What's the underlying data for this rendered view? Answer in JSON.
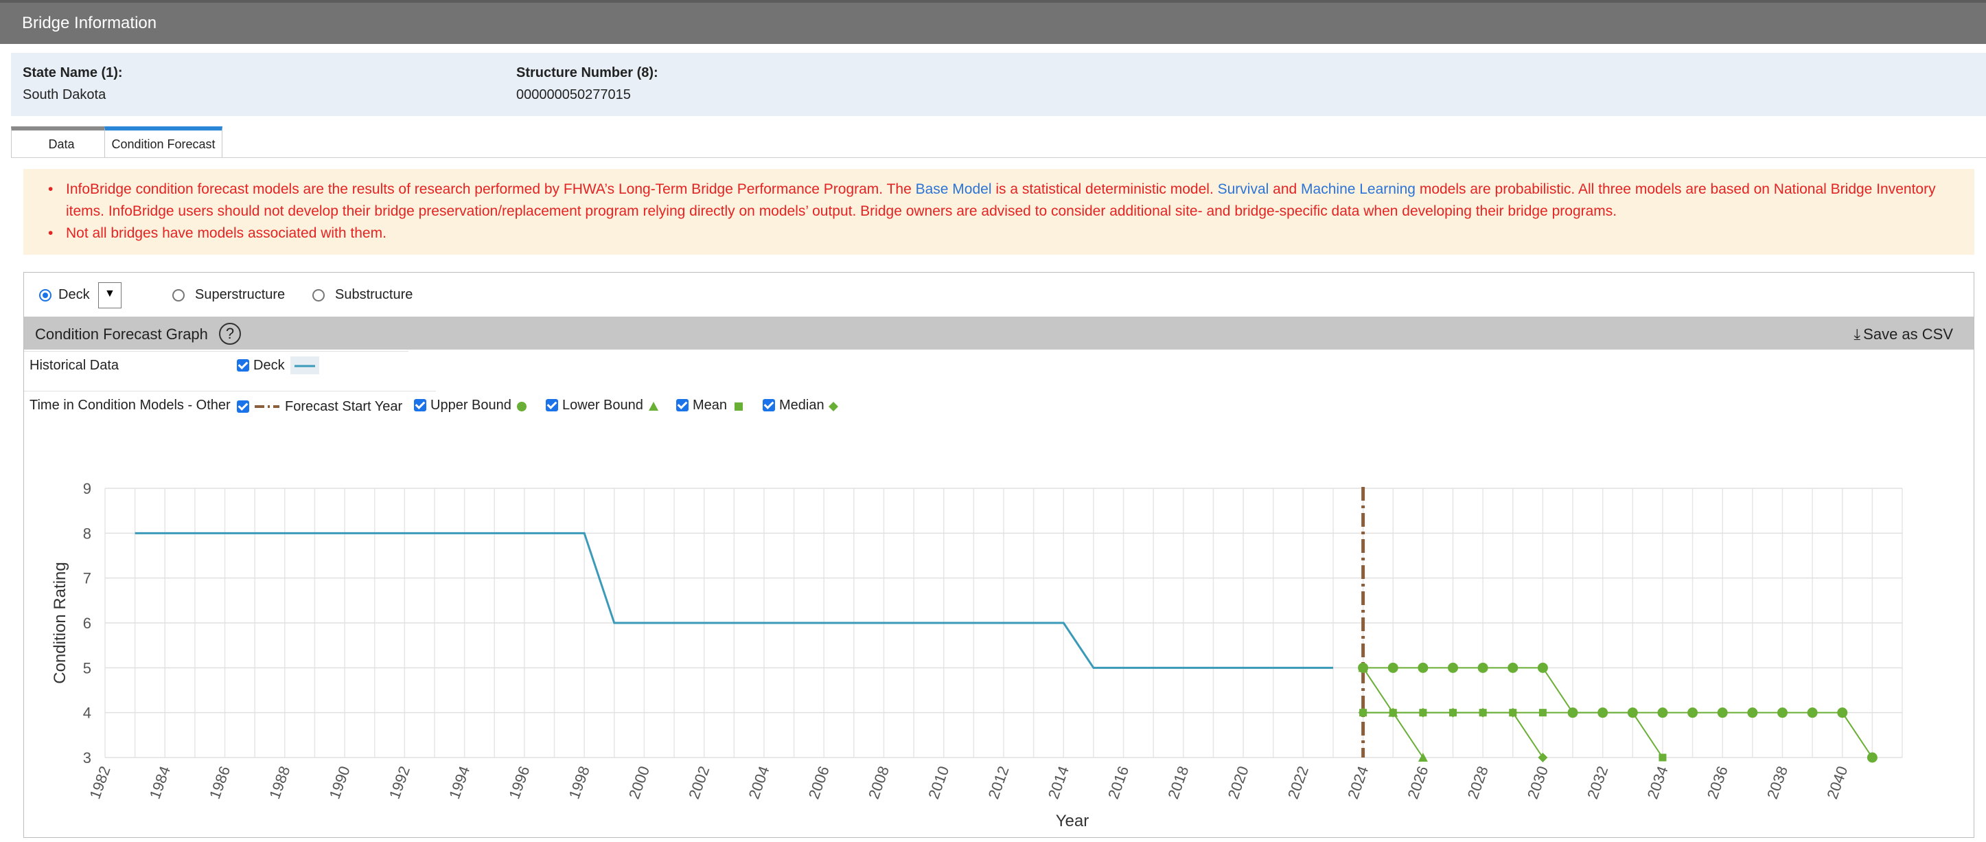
{
  "window": {
    "title": "Bridge Information"
  },
  "info": {
    "state_label": "State Name (1):",
    "state_value": "South Dakota",
    "structure_label": "Structure Number (8):",
    "structure_value": "000000050277015"
  },
  "tabs": [
    {
      "label": "Data",
      "active": false
    },
    {
      "label": "Condition Forecast",
      "active": true
    }
  ],
  "notice": {
    "line1_a": "InfoBridge condition forecast models are the results of research performed by FHWA’s Long-Term Bridge Performance Program. The ",
    "link_base": "Base Model",
    "line1_b": " is a statistical deterministic model. ",
    "link_survival": "Survival",
    "line1_c": " and ",
    "link_ml": "Machine Learning",
    "line1_d": " models are probabilistic. All three models are based on National Bridge Inventory items. InfoBridge users should not develop their bridge preservation/replacement program relying directly on models’ output. Bridge owners are advised to consider additional site- and bridge-specific data when developing their bridge programs.",
    "line2": "Not all bridges have models associated with them."
  },
  "component_selector": {
    "options": [
      "Deck",
      "Superstructure",
      "Substructure"
    ],
    "selected": "Deck"
  },
  "graph": {
    "title": "Condition Forecast Graph",
    "help_icon": "question-circle-icon",
    "save_label": "Save as CSV",
    "save_icon": "download-icon"
  },
  "legend": {
    "historical_label": "Historical Data",
    "historical_items": [
      {
        "label": "Deck",
        "checked": true,
        "color": "#3a9ab8"
      }
    ],
    "models_label": "Time in Condition Models - Other",
    "model_items": [
      {
        "label": "Forecast Start Year",
        "checked": true,
        "color": "#8b5e3c"
      },
      {
        "label": "Upper Bound",
        "checked": true,
        "color": "#6aaf35"
      },
      {
        "label": "Lower Bound",
        "checked": true,
        "color": "#6aaf35"
      },
      {
        "label": "Mean",
        "checked": true,
        "color": "#6aaf35"
      },
      {
        "label": "Median",
        "checked": true,
        "color": "#6aaf35"
      }
    ]
  },
  "chart_data": {
    "type": "line",
    "xlabel": "Year",
    "ylabel": "Condition Rating",
    "xlim": [
      1982,
      2042
    ],
    "ylim": [
      3,
      9
    ],
    "x_ticks": [
      1982,
      1984,
      1986,
      1988,
      1990,
      1992,
      1994,
      1996,
      1998,
      2000,
      2002,
      2004,
      2006,
      2008,
      2010,
      2012,
      2014,
      2016,
      2018,
      2020,
      2022,
      2024,
      2026,
      2028,
      2030,
      2032,
      2034,
      2036,
      2038,
      2040
    ],
    "y_ticks": [
      3,
      4,
      5,
      6,
      7,
      8,
      9
    ],
    "grid": true,
    "forecast_start_year": 2024,
    "series": [
      {
        "name": "Deck",
        "color": "#3a9ab8",
        "style": "line",
        "points": [
          [
            1983,
            8
          ],
          [
            1998,
            8
          ],
          [
            1999,
            6
          ],
          [
            2014,
            6
          ],
          [
            2015,
            5
          ],
          [
            2023,
            5
          ]
        ]
      },
      {
        "name": "Upper Bound",
        "color": "#6aaf35",
        "marker": "circle",
        "points": [
          [
            2024,
            5
          ],
          [
            2025,
            5
          ],
          [
            2026,
            5
          ],
          [
            2027,
            5
          ],
          [
            2028,
            5
          ],
          [
            2029,
            5
          ],
          [
            2030,
            5
          ],
          [
            2031,
            4
          ],
          [
            2032,
            4
          ],
          [
            2033,
            4
          ],
          [
            2034,
            4
          ],
          [
            2035,
            4
          ],
          [
            2036,
            4
          ],
          [
            2037,
            4
          ],
          [
            2038,
            4
          ],
          [
            2039,
            4
          ],
          [
            2040,
            4
          ],
          [
            2041,
            3
          ]
        ]
      },
      {
        "name": "Lower Bound",
        "color": "#6aaf35",
        "marker": "triangle",
        "points": [
          [
            2024,
            5
          ],
          [
            2025,
            4
          ],
          [
            2026,
            3
          ]
        ]
      },
      {
        "name": "Mean",
        "color": "#6aaf35",
        "marker": "square",
        "points": [
          [
            2024,
            4
          ],
          [
            2025,
            4
          ],
          [
            2026,
            4
          ],
          [
            2027,
            4
          ],
          [
            2028,
            4
          ],
          [
            2029,
            4
          ],
          [
            2030,
            4
          ],
          [
            2031,
            4
          ],
          [
            2032,
            4
          ],
          [
            2033,
            4
          ],
          [
            2034,
            3
          ]
        ]
      },
      {
        "name": "Median",
        "color": "#6aaf35",
        "marker": "diamond",
        "points": [
          [
            2024,
            4
          ],
          [
            2025,
            4
          ],
          [
            2026,
            4
          ],
          [
            2027,
            4
          ],
          [
            2028,
            4
          ],
          [
            2029,
            4
          ],
          [
            2030,
            3
          ]
        ]
      }
    ]
  }
}
